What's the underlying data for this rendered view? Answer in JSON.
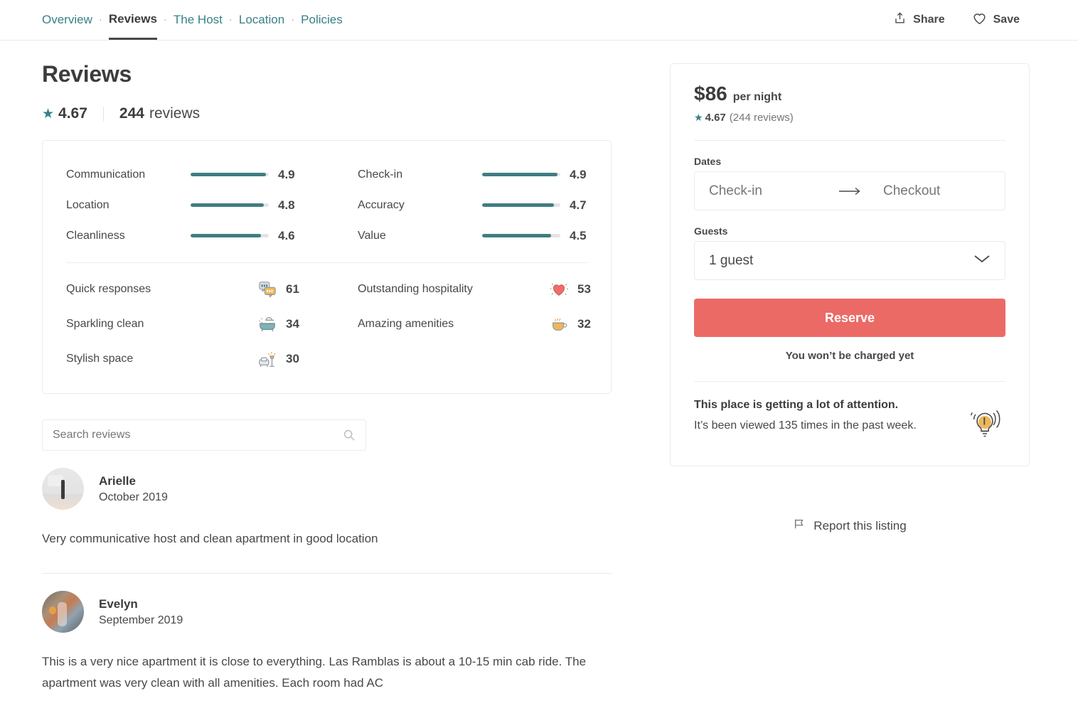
{
  "nav": {
    "items": [
      {
        "label": "Overview",
        "active": false
      },
      {
        "label": "Reviews",
        "active": true
      },
      {
        "label": "The Host",
        "active": false
      },
      {
        "label": "Location",
        "active": false
      },
      {
        "label": "Policies",
        "active": false
      }
    ],
    "separator": "·",
    "share_label": "Share",
    "share_icon": "share-upload-icon",
    "save_label": "Save",
    "save_icon": "heart-outline-icon"
  },
  "reviews_section": {
    "title": "Reviews",
    "star_icon": "star-icon",
    "rating": "4.67",
    "review_count": "244",
    "review_count_word": "reviews"
  },
  "rating_breakdown": {
    "left": [
      {
        "label": "Communication",
        "value": "4.9",
        "pct": 96
      },
      {
        "label": "Location",
        "value": "4.8",
        "pct": 94
      },
      {
        "label": "Cleanliness",
        "value": "4.6",
        "pct": 90
      }
    ],
    "right": [
      {
        "label": "Check-in",
        "value": "4.9",
        "pct": 96
      },
      {
        "label": "Accuracy",
        "value": "4.7",
        "pct": 92
      },
      {
        "label": "Value",
        "value": "4.5",
        "pct": 88
      }
    ]
  },
  "highlight_tags": {
    "left": [
      {
        "label": "Quick responses",
        "count": "61",
        "icon": "speech-bubbles-icon"
      },
      {
        "label": "Sparkling clean",
        "count": "34",
        "icon": "bathtub-icon"
      },
      {
        "label": "Stylish space",
        "count": "30",
        "icon": "armchair-lamp-icon"
      }
    ],
    "right": [
      {
        "label": "Outstanding hospitality",
        "count": "53",
        "icon": "sparkling-heart-icon"
      },
      {
        "label": "Amazing amenities",
        "count": "32",
        "icon": "coffee-cup-icon"
      }
    ]
  },
  "search": {
    "placeholder": "Search reviews",
    "value": "",
    "icon": "search-icon"
  },
  "reviews": [
    {
      "name": "Arielle",
      "date": "October 2019",
      "body": "Very communicative host and clean apartment in good location",
      "avatar": "avatar-arielle"
    },
    {
      "name": "Evelyn",
      "date": "September 2019",
      "body": "This is a very nice apartment it is close to everything. Las Ramblas is about a 10-15 min cab ride. The apartment was very clean with all amenities. Each room had AC",
      "avatar": "avatar-evelyn"
    }
  ],
  "booking": {
    "price": "$86",
    "per_night": "per night",
    "star_icon": "star-icon",
    "rating": "4.67",
    "review_count_text": "(244 reviews)",
    "dates_label": "Dates",
    "checkin_placeholder": "Check-in",
    "checkout_placeholder": "Checkout",
    "arrow_icon": "arrow-right-icon",
    "guests_label": "Guests",
    "guests_value": "1 guest",
    "chevron_icon": "chevron-down-icon",
    "reserve_label": "Reserve",
    "no_charge_note": "You won’t be charged yet",
    "attention_title": "This place is getting a lot of attention.",
    "attention_sub": "It’s been viewed 135 times in the past week.",
    "attention_icon": "lightbulb-icon",
    "report_label": "Report this listing",
    "report_icon": "flag-icon"
  },
  "colors": {
    "accent_teal": "#378087",
    "bar_fill": "#3f7e83",
    "reserve_red": "#ec6a66",
    "text_dark": "#3c3c3c",
    "text_body": "#484848",
    "border": "#ebebeb"
  }
}
